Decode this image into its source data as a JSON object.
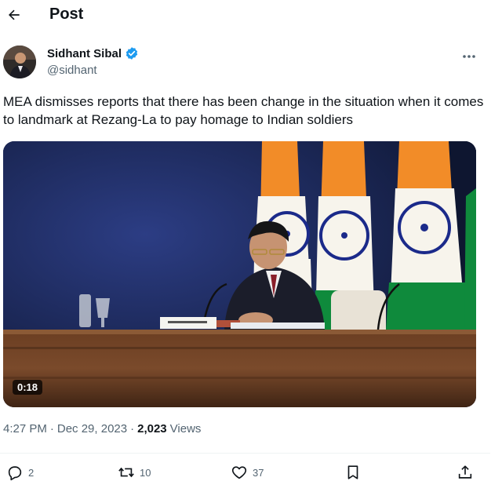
{
  "header": {
    "title": "Post"
  },
  "author": {
    "display_name": "Sidhant Sibal",
    "handle": "@sidhant",
    "verified": true
  },
  "tweet": {
    "text": "MEA dismisses reports that there has been change in the situation when it comes to landmark at Rezang-La to pay homage to Indian soldiers",
    "video_time": "0:18"
  },
  "meta": {
    "time": "4:27 PM",
    "date": "Dec 29, 2023",
    "views_count": "2,023",
    "views_label": "Views"
  },
  "actions": {
    "replies": "2",
    "reposts": "10",
    "likes": "37"
  },
  "colors": {
    "accent": "#1d9bf0",
    "secondary_text": "#536471",
    "saffron": "#f28c28",
    "green": "#0f8a3c",
    "chakra": "#1b2a8a"
  }
}
